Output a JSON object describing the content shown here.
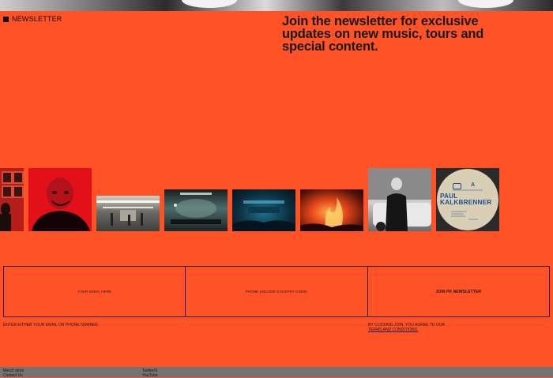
{
  "section": {
    "label": "NEWSLETTER",
    "headline": "Join the newsletter for exclusive updates on new music, tours and special content."
  },
  "vinyl": {
    "title": "PAUL KALKBRENNER",
    "side": "A"
  },
  "form": {
    "email_placeholder": "YOUR EMAIL HERE",
    "phone_placeholder": "PHONE (INLCIDE COUNTRY CODE)",
    "join_label": "JOIN PK NEWSLETTER",
    "hint": "ENTER EITHER YOUR EMAIL OR PHONE NUMBER.",
    "terms_prefix": "BY CLICKING JOIN, YOU AGREE TO OUR",
    "terms_link": "TERMS AND CONDITIONS."
  },
  "footer": {
    "col1": [
      "Merch store",
      "Contact Us"
    ],
    "col2": [
      "Twitter/X",
      "YouTube"
    ]
  },
  "colors": {
    "accent": "#FF5227",
    "footer_bg": "#737373"
  }
}
